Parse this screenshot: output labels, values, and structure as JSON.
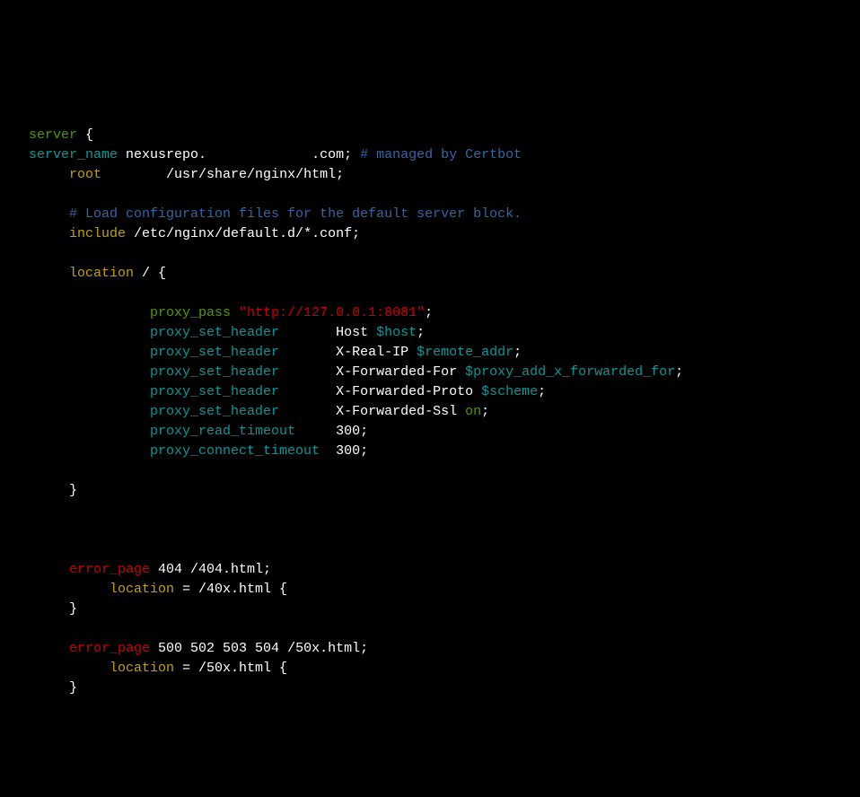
{
  "code": {
    "l1": {
      "server": "server",
      "brace": " {"
    },
    "l2": {
      "server_name": "server_name",
      "value": " nexusrepo.             .com;",
      "comment": " # managed by Certbot"
    },
    "l3": {
      "root": "root",
      "value": "        /usr/share/nginx/html;"
    },
    "l4": {
      "comment": "# Load configuration files for the default server block."
    },
    "l5": {
      "include": "include",
      "value": " /etc/nginx/default.d/*.conf;"
    },
    "l6": {
      "location": "location",
      "value": " / {"
    },
    "l7": {
      "proxy_pass": "proxy_pass",
      "str": " \"http://127.0.0.1:8081\"",
      "semi": ";"
    },
    "l8": {
      "dir": "proxy_set_header",
      "pad": "       ",
      "key": "Host ",
      "var": "$host",
      "semi": ";"
    },
    "l9": {
      "dir": "proxy_set_header",
      "pad": "       ",
      "key": "X-Real-IP ",
      "var": "$remote_addr",
      "semi": ";"
    },
    "l10": {
      "dir": "proxy_set_header",
      "pad": "       ",
      "key": "X-Forwarded-For ",
      "var": "$proxy_add_x_forwarded_for",
      "semi": ";"
    },
    "l11": {
      "dir": "proxy_set_header",
      "pad": "       ",
      "key": "X-Forwarded-Proto ",
      "var": "$scheme",
      "semi": ";"
    },
    "l12": {
      "dir": "proxy_set_header",
      "pad": "       ",
      "key": "X-Forwarded-Ssl ",
      "on": "on",
      "semi": ";"
    },
    "l13": {
      "dir": "proxy_read_timeout",
      "pad": "     ",
      "val": "300;"
    },
    "l14": {
      "dir": "proxy_connect_timeout",
      "pad": "  ",
      "val": "300;"
    },
    "l15": {
      "brace": "}"
    },
    "l16": {
      "error_page": "error_page",
      "codes": " 404",
      "path": " /404.html;"
    },
    "l17": {
      "location": "location",
      "value": " = /40x.html {"
    },
    "l18": {
      "brace": "}"
    },
    "l19": {
      "error_page": "error_page",
      "codes": " 500 502 503 504",
      "path": " /50x.html;"
    },
    "l20": {
      "location": "location",
      "value": " = /50x.html {"
    },
    "l21": {
      "brace": "}"
    }
  }
}
